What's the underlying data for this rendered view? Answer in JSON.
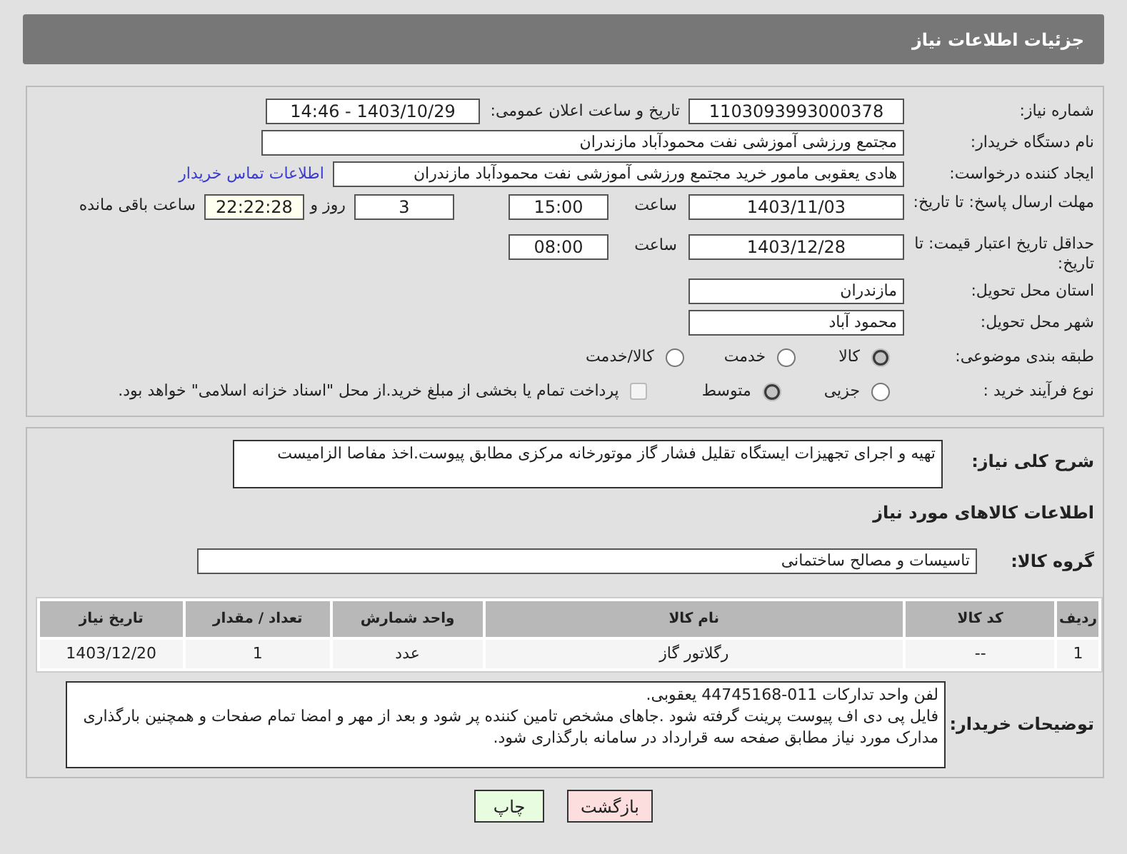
{
  "header": {
    "title": "جزئیات اطلاعات نیاز"
  },
  "need_number": {
    "label": "شماره نیاز:",
    "value": "1103093993000378"
  },
  "announce": {
    "label": "تاریخ و ساعت اعلان عمومی:",
    "value": "1403/10/29 - 14:46"
  },
  "buyer_org": {
    "label": "نام دستگاه خریدار:",
    "value": "مجتمع ورزشی آموزشی نفت محمودآباد مازندران"
  },
  "requester": {
    "label": "ایجاد کننده درخواست:",
    "value": "هادی یعقوبی مامور خرید مجتمع ورزشی آموزشی نفت محمودآباد مازندران",
    "link": "اطلاعات تماس خریدار"
  },
  "reply_deadline": {
    "label": "مهلت ارسال پاسخ: تا تاریخ:",
    "date": "1403/11/03",
    "time_label": "ساعت",
    "time": "15:00",
    "days": "3",
    "days_label": "روز و",
    "remaining": "22:22:28",
    "remaining_label": "ساعت باقی مانده"
  },
  "price_validity": {
    "label": "حداقل تاریخ اعتبار قیمت: تا تاریخ:",
    "date": "1403/12/28",
    "time_label": "ساعت",
    "time": "08:00"
  },
  "province": {
    "label": "استان محل تحویل:",
    "value": "مازندران"
  },
  "city": {
    "label": "شهر محل تحویل:",
    "value": "محمود آباد"
  },
  "category": {
    "label": "طبقه بندی موضوعی:",
    "options": [
      {
        "label": "کالا",
        "selected": true
      },
      {
        "label": "خدمت",
        "selected": false
      },
      {
        "label": "کالا/خدمت",
        "selected": false
      }
    ]
  },
  "purchase_type": {
    "label": "نوع فرآیند خرید :",
    "options": [
      {
        "label": "جزیی",
        "selected": false
      },
      {
        "label": "متوسط",
        "selected": true
      }
    ],
    "treasury": {
      "label": "پرداخت تمام یا بخشی از مبلغ خرید.از محل \"اسناد خزانه اسلامی\" خواهد بود.",
      "checked": false
    }
  },
  "description": {
    "label": "شرح کلی نیاز:",
    "value": "تهیه و اجرای تجهیزات ایستگاه تقلیل فشار گاز موتورخانه مرکزی مطابق پیوست.اخذ مفاصا الزامیست"
  },
  "goods_title": "اطلاعات کالاهای مورد نیاز",
  "goods_group": {
    "label": "گروه کالا:",
    "value": "تاسیسات و مصالح ساختمانی"
  },
  "table": {
    "columns": [
      "ردیف",
      "کد کالا",
      "نام کالا",
      "واحد شمارش",
      "تعداد / مقدار",
      "تاریخ نیاز"
    ],
    "rows": [
      [
        "1",
        "--",
        "رگلاتور گاز",
        "عدد",
        "1",
        "1403/12/20"
      ]
    ]
  },
  "buyer_notes": {
    "label": "توضیحات خریدار:",
    "value": "لفن واحد تدارکات 011-44745168 یعقوبی.\nفایل پی دی اف پیوست پرینت گرفته شود .جاهای مشخص تامین کننده پر شود و بعد از مهر و امضا تمام صفحات و همچنین بارگذاری مدارک مورد نیاز مطابق صفحه سه قرارداد در سامانه بارگذاری شود."
  },
  "buttons": [
    {
      "label": "بازگشت",
      "kind": "back"
    },
    {
      "label": "چاپ",
      "kind": "print"
    }
  ]
}
